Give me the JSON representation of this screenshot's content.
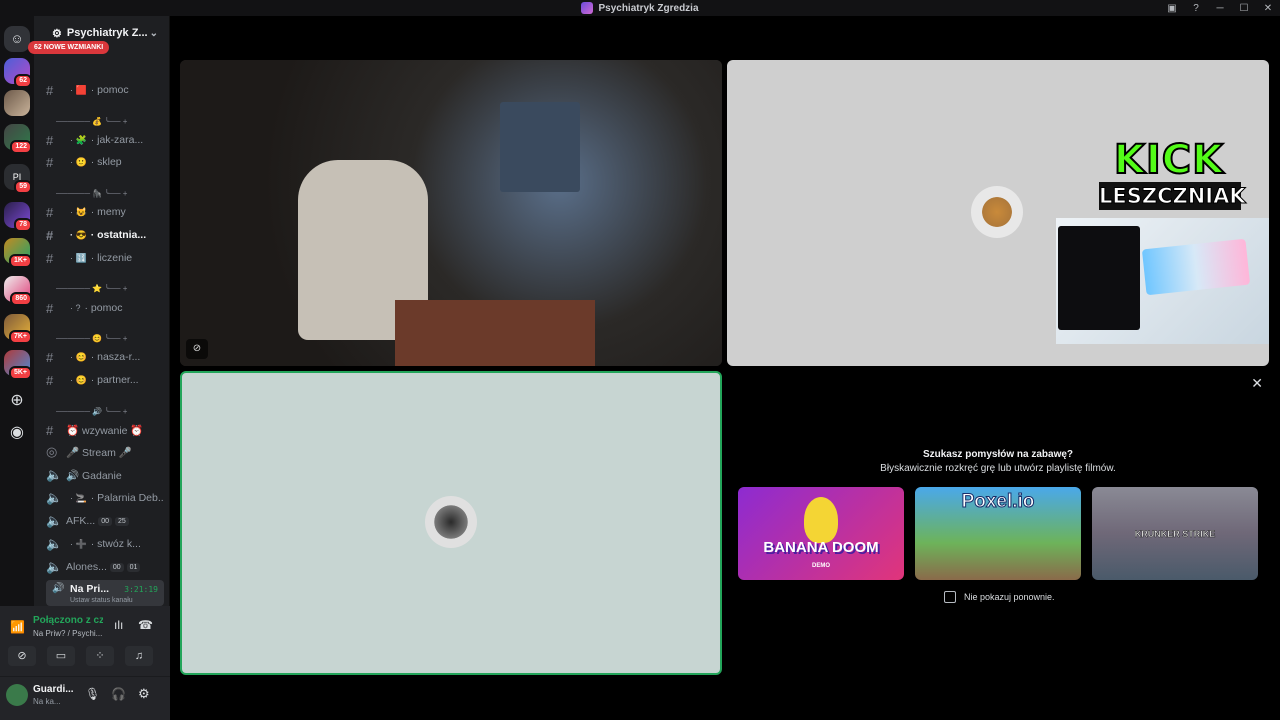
{
  "window": {
    "title": "Psychiatryk Zgredzia"
  },
  "servers": {
    "badges": [
      "62",
      "122",
      "59",
      "78",
      "1K+",
      "860",
      "7K+",
      "5K+"
    ]
  },
  "guild": {
    "name": "Psychiatryk Z...",
    "mentions_banner": "62 NOWE WZMIANKI"
  },
  "channels": [
    {
      "name": "pomoc",
      "emoji": "🟥",
      "kind": "text"
    },
    {
      "name": "jak-zara...",
      "emoji": "🧩",
      "kind": "text"
    },
    {
      "name": "sklep",
      "emoji": "🙂",
      "kind": "text"
    },
    {
      "name": "memy",
      "emoji": "😺",
      "kind": "text"
    },
    {
      "name": "ostatnia...",
      "emoji": "😎",
      "kind": "text",
      "active": true
    },
    {
      "name": "liczenie",
      "emoji": "🔢",
      "kind": "text"
    },
    {
      "name": "pomoc",
      "emoji": "?",
      "kind": "text"
    },
    {
      "name": "nasza-r...",
      "emoji": "😊",
      "kind": "text"
    },
    {
      "name": "partner...",
      "emoji": "😊",
      "kind": "text"
    },
    {
      "name": "⏰ wzywanie ⏰",
      "emoji": "",
      "kind": "text"
    },
    {
      "name": "🎤 Stream 🎤",
      "emoji": "",
      "kind": "stage"
    },
    {
      "name": "🔊 Gadanie",
      "emoji": "",
      "kind": "voice"
    },
    {
      "name": "Palarnia Deb...",
      "emoji": "🚬",
      "kind": "voice"
    },
    {
      "name": "AFK...",
      "kind": "voice",
      "p1": "00",
      "p2": "25"
    },
    {
      "name": "stwóz k...",
      "emoji": "➕",
      "kind": "voice"
    },
    {
      "name": "Alones...",
      "kind": "voice",
      "p1": "00",
      "p2": "01"
    }
  ],
  "voice_channel": {
    "name": "Na Pri...",
    "timer": "3:21:19",
    "status_hint": "Ustaw status kanału"
  },
  "connection": {
    "status": "Połączono z czat",
    "channel": "Na Priw? / Psychi..."
  },
  "user": {
    "name": "Guardi...",
    "status": "Na ka..."
  },
  "stream_overlay": {
    "line1": "KICK",
    "line2": "LESZCZNIAK"
  },
  "activity": {
    "title": "Szukasz pomysłów na zabawę?",
    "subtitle": "Błyskawicznie rozkręć grę lub utwórz playlistę filmów.",
    "games": [
      "BANANA DOOM",
      "Poxel.io",
      "KRUNKER STRIKE"
    ],
    "game_tags": [
      "DEMO",
      "",
      ""
    ],
    "dont_show": "Nie pokazuj ponownie.",
    "colors": {
      "tile_border": "#23a55a"
    }
  }
}
